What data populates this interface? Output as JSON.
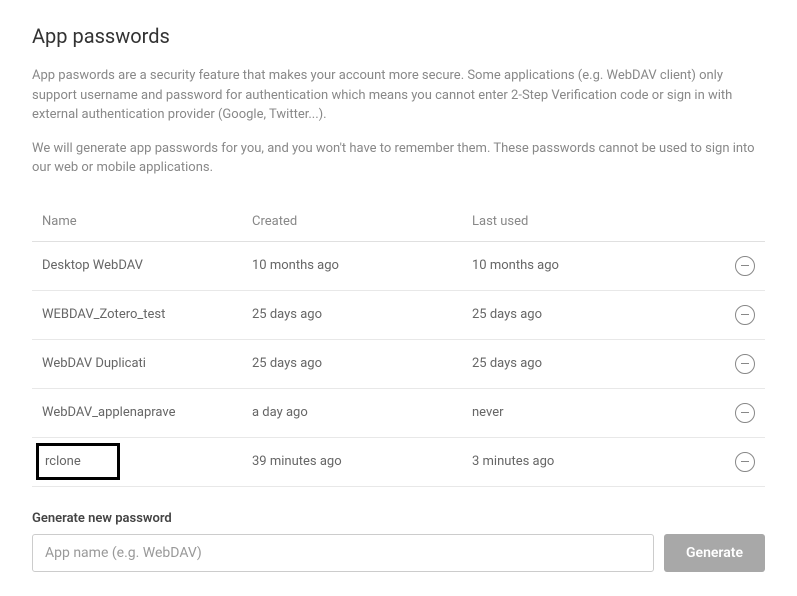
{
  "title": "App passwords",
  "description1": "App paswords are a security feature that makes your account more secure. Some applications (e.g. WebDAV client) only support username and password for authentication which means you cannot enter 2-Step Verification code or sign in with external authentication provider (Google, Twitter...).",
  "description2": "We will generate app passwords for you, and you won't have to remember them. These passwords cannot be used to sign into our web or mobile applications.",
  "columns": {
    "name": "Name",
    "created": "Created",
    "lastused": "Last used"
  },
  "rows": [
    {
      "name": "Desktop WebDAV",
      "created": "10 months ago",
      "lastused": "10 months ago",
      "highlight": false
    },
    {
      "name": "WEBDAV_Zotero_test",
      "created": "25 days ago",
      "lastused": "25 days ago",
      "highlight": false
    },
    {
      "name": "WebDAV Duplicati",
      "created": "25 days ago",
      "lastused": "25 days ago",
      "highlight": false
    },
    {
      "name": "WebDAV_applenaprave",
      "created": "a day ago",
      "lastused": "never",
      "highlight": false
    },
    {
      "name": "rclone",
      "created": "39 minutes ago",
      "lastused": "3 minutes ago",
      "highlight": true
    }
  ],
  "form": {
    "label": "Generate new password",
    "placeholder": "App name (e.g. WebDAV)",
    "button": "Generate"
  }
}
